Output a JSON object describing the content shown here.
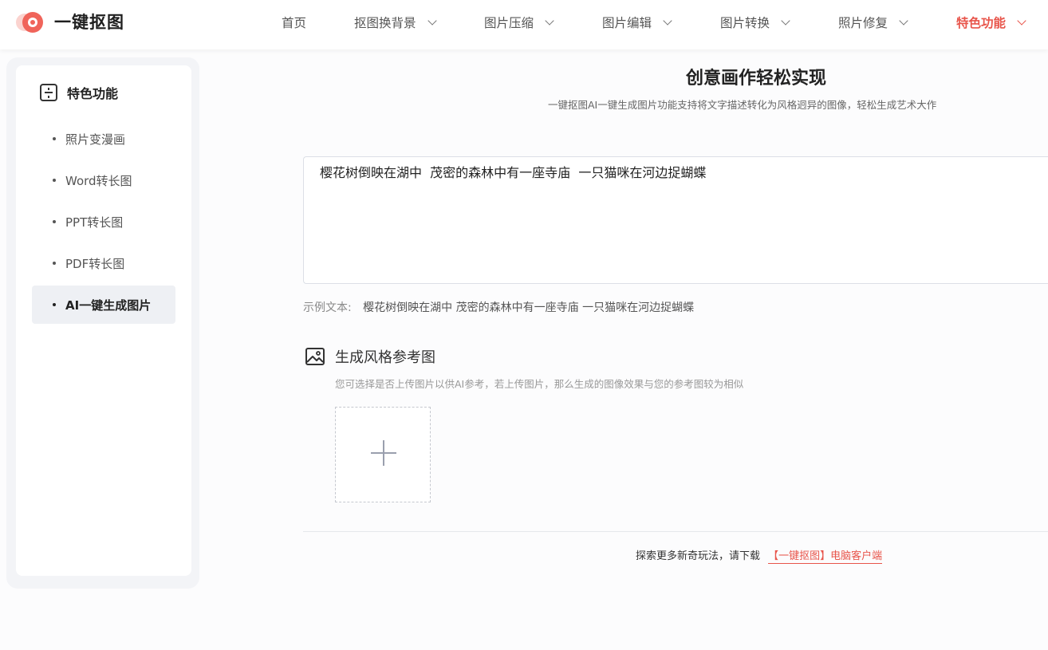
{
  "header": {
    "logo_text": "一键抠图",
    "nav": [
      {
        "label": "首页",
        "has_dropdown": false
      },
      {
        "label": "抠图换背景",
        "has_dropdown": true
      },
      {
        "label": "图片压缩",
        "has_dropdown": true
      },
      {
        "label": "图片编辑",
        "has_dropdown": true
      },
      {
        "label": "图片转换",
        "has_dropdown": true
      },
      {
        "label": "照片修复",
        "has_dropdown": true
      },
      {
        "label": "特色功能",
        "has_dropdown": true,
        "active": true
      }
    ]
  },
  "sidebar": {
    "title": "特色功能",
    "items": [
      {
        "label": "照片变漫画"
      },
      {
        "label": "Word转长图"
      },
      {
        "label": "PPT转长图"
      },
      {
        "label": "PDF转长图"
      },
      {
        "label": "AI一键生成图片",
        "active": true
      }
    ]
  },
  "main": {
    "title": "创意画作轻松实现",
    "subtitle": "一键抠图AI一键生成图片功能支持将文字描述转化为风格迥异的图像，轻松生成艺术大作",
    "prompt_value": "樱花树倒映在湖中  茂密的森林中有一座寺庙  一只猫咪在河边捉蝴蝶",
    "example_label": "示例文本:",
    "example_text": "樱花树倒映在湖中  茂密的森林中有一座寺庙  一只猫咪在河边捉蝴蝶",
    "ref_title": "生成风格参考图",
    "ref_desc": "您可选择是否上传图片以供AI参考，若上传图片，那么生成的图像效果与您的参考图较为相似",
    "footer_text": "探索更多新奇玩法，请下载",
    "footer_link": "【一键抠图】电脑客户端"
  },
  "colors": {
    "accent": "#e8554b",
    "active_bg": "#eef0f4",
    "page_bg": "#fcfcfd"
  }
}
